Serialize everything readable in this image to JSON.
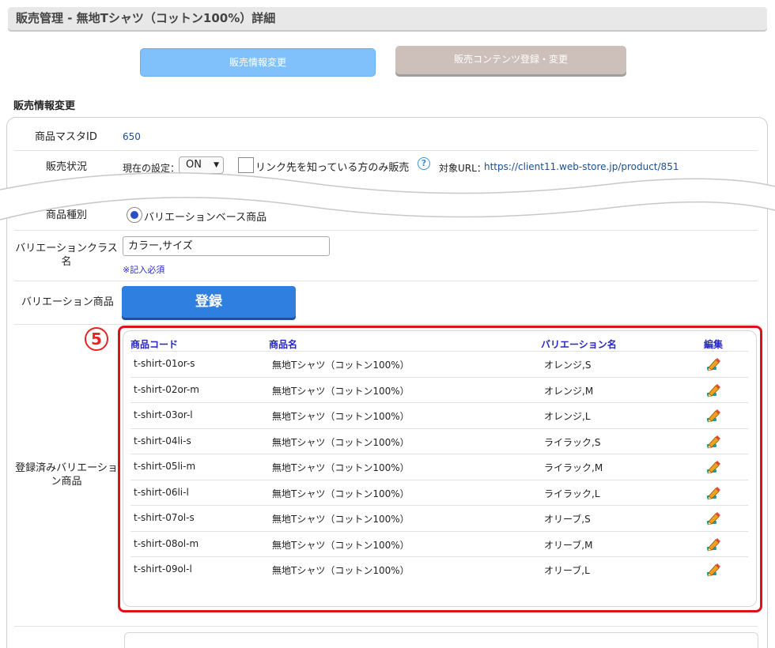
{
  "header": {
    "title": "販売管理 - 無地Tシャツ（コットン100%）詳細"
  },
  "tabs": [
    {
      "label": "販売情報変更",
      "active": true
    },
    {
      "label": "販売コンテンツ登録・変更",
      "active": false
    }
  ],
  "section": {
    "title": "販売情報変更"
  },
  "form": {
    "master_id": {
      "label": "商品マスタID",
      "value": "650"
    },
    "sales_status": {
      "label": "販売状況",
      "current_setting_label": "現在の設定：",
      "select_value": "ON",
      "link_only_label": "リンク先を知っている方のみ販売",
      "link_only_checked": false,
      "target_url_label": "対象URL：",
      "target_url": "https://client11.web-store.jp/product/851"
    },
    "product_type": {
      "label": "商品種別",
      "option": "バリエーションベース商品",
      "selected": true
    },
    "variation_class": {
      "label": "バリエーションクラス名",
      "value": "カラー,サイズ",
      "required_note": "※記入必須"
    },
    "variation_product": {
      "label": "バリエーション商品",
      "button": "登録"
    },
    "registered_variations": {
      "label": "登録済みバリエーション商品",
      "badge": "5",
      "columns": [
        "商品コード",
        "商品名",
        "バリエーション名",
        "編集"
      ],
      "rows": [
        {
          "code": "t-shirt-01or-s",
          "name": "無地Tシャツ（コットン100%）",
          "variation": "オレンジ,S"
        },
        {
          "code": "t-shirt-02or-m",
          "name": "無地Tシャツ（コットン100%）",
          "variation": "オレンジ,M"
        },
        {
          "code": "t-shirt-03or-l",
          "name": "無地Tシャツ（コットン100%）",
          "variation": "オレンジ,L"
        },
        {
          "code": "t-shirt-04li-s",
          "name": "無地Tシャツ（コットン100%）",
          "variation": "ライラック,S"
        },
        {
          "code": "t-shirt-05li-m",
          "name": "無地Tシャツ（コットン100%）",
          "variation": "ライラック,M"
        },
        {
          "code": "t-shirt-06li-l",
          "name": "無地Tシャツ（コットン100%）",
          "variation": "ライラック,L"
        },
        {
          "code": "t-shirt-07ol-s",
          "name": "無地Tシャツ（コットン100%）",
          "variation": "オリーブ,S"
        },
        {
          "code": "t-shirt-08ol-m",
          "name": "無地Tシャツ（コットン100%）",
          "variation": "オリーブ,M"
        },
        {
          "code": "t-shirt-09ol-l",
          "name": "無地Tシャツ（コットン100%）",
          "variation": "オリーブ,L"
        }
      ]
    }
  },
  "colors": {
    "accent": "#2f7fe0",
    "highlight": "#e0101a",
    "header_link": "#2525c8"
  },
  "icons": {
    "edit": "pencil-edit-icon",
    "help": "question-circle-icon"
  }
}
